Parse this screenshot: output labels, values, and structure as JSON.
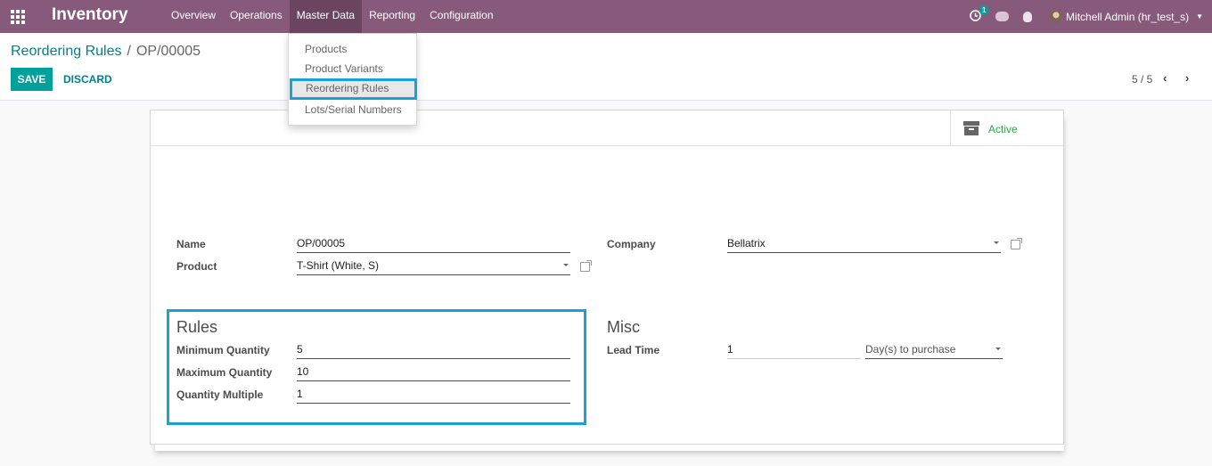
{
  "navbar": {
    "app_title": "Inventory",
    "menu": [
      "Overview",
      "Operations",
      "Master Data",
      "Reporting",
      "Configuration"
    ],
    "notification_count": "1",
    "user_name": "Mitchell Admin (hr_test_s)"
  },
  "dropdown": {
    "items": [
      "Products",
      "Product Variants",
      "Reordering Rules",
      "Lots/Serial Numbers"
    ],
    "active_item": "Reordering Rules"
  },
  "breadcrumb": {
    "parent": "Reordering Rules",
    "separator": "/",
    "current": "OP/00005"
  },
  "actions": {
    "save_label": "SAVE",
    "discard_label": "DISCARD"
  },
  "pager": {
    "value": "5 / 5",
    "prev_icon": "chevron-left-icon",
    "next_icon": "chevron-right-icon"
  },
  "status_button": {
    "label": "Active",
    "icon": "archive-icon",
    "color": "#28a745"
  },
  "form": {
    "name_label": "Name",
    "name_value": "OP/00005",
    "product_label": "Product",
    "product_value": "T-Shirt (White, S)",
    "company_label": "Company",
    "company_value": "Bellatrix",
    "rules": {
      "title": "Rules",
      "min_label": "Minimum Quantity",
      "min_value": "5",
      "max_label": "Maximum Quantity",
      "max_value": "10",
      "multiple_label": "Quantity Multiple",
      "multiple_value": "1"
    },
    "misc": {
      "title": "Misc",
      "lead_time_label": "Lead Time",
      "lead_time_value": "1",
      "lead_type_value": "Day(s) to purchase"
    }
  },
  "colors": {
    "brand": "#875a7b",
    "primary": "#00a09d",
    "link": "#00818a",
    "highlight": "#1aa2d8"
  }
}
